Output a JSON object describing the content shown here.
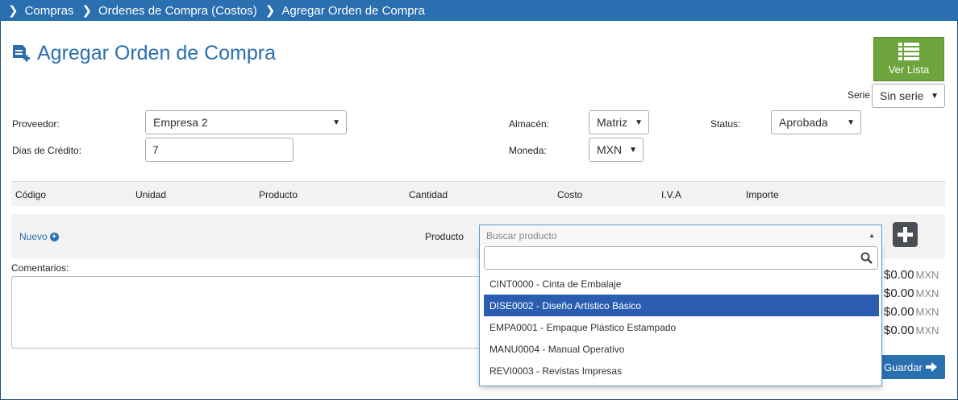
{
  "breadcrumb": [
    "Compras",
    "Ordenes de Compra (Costos)",
    "Agregar Orden de Compra"
  ],
  "page_title": "Agregar Orden de Compra",
  "ver_lista_label": "Ver Lista",
  "serie": {
    "label": "Serie",
    "value": "Sin serie"
  },
  "form": {
    "proveedor_label": "Proveedor:",
    "proveedor_value": "Empresa 2",
    "dias_label": "Dias de Crédito:",
    "dias_value": "7",
    "almacen_label": "Almacén:",
    "almacen_value": "Matriz",
    "moneda_label": "Moneda:",
    "moneda_value": "MXN",
    "status_label": "Status:",
    "status_value": "Aprobada"
  },
  "table_headers": [
    "Código",
    "Unidad",
    "Producto",
    "Cantidad",
    "Costo",
    "I.V.A",
    "Importe"
  ],
  "add_row": {
    "nuevo_label": "Nuevo",
    "producto_label": "Producto",
    "producto_placeholder": "Buscar producto"
  },
  "comentarios_label": "Comentarios:",
  "totals": [
    {
      "amount": "$0.00",
      "currency": "MXN"
    },
    {
      "amount": "$0.00",
      "currency": "MXN"
    },
    {
      "amount": "$0.00",
      "currency": "MXN"
    },
    {
      "amount": "$0.00",
      "currency": "MXN"
    }
  ],
  "guardar_label": "Guardar",
  "dropdown_options": [
    "CINT0000 - Cinta de Embalaje",
    "DISE0002 - Diseño Artístico Básico",
    "EMPA0001 - Empaque Plástico Estampado",
    "MANU0004 - Manual Operativo",
    "REVI0003 - Revistas Impresas"
  ],
  "dropdown_active_index": 1,
  "colors": {
    "primary": "#2a6fb0",
    "success": "#6da43b",
    "highlight": "#2a5db0"
  }
}
